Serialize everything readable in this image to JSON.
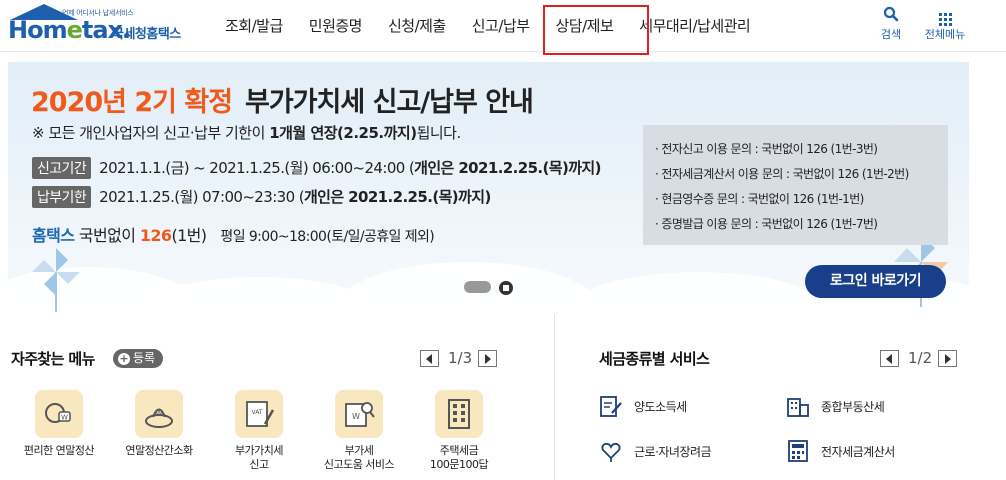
{
  "header": {
    "logo_sub": "언제 어디서나 납세서비스",
    "logo_main_pre": "Hom",
    "logo_main_e": "e",
    "logo_main_post": "tax.",
    "logo_kor": "국세청홈택스",
    "nav": [
      "조회/발급",
      "민원증명",
      "신청/제출",
      "신고/납부",
      "상담/제보",
      "세무대리/납세관리"
    ],
    "search_label": "검색",
    "all_menu_label": "전체메뉴"
  },
  "banner": {
    "title_orange": "2020년 2기 확정",
    "title_dark": "부가가치세 신고/납부 안내",
    "notice_pre": "※ 모든 개인사업자의 신고·납부 기한이 ",
    "notice_bold": "1개월 연장(2.25.까지)",
    "notice_post": "됩니다.",
    "report_tag": "신고기간",
    "report_text": "2021.1.1.(금) ~ 2021.1.25.(월) 06:00~24:00 (",
    "report_bold": "개인은 2021.2.25.(목)",
    "report_end": "까지)",
    "pay_tag": "납부기한",
    "pay_text": "2021.1.25.(월) 07:00~23:30 (",
    "pay_bold": "개인은 2021.2.25.(목)",
    "pay_end": "까지)",
    "contact_hometax": "홈택스",
    "contact_mid": " 국번없이 ",
    "contact_num": "126",
    "contact_ext": "(1번)",
    "contact_hours": "평일 9:00~18:00(토/일/공휴일 제외)",
    "info": [
      "· 전자신고 이용 문의 : 국번없이 126 (1번-3번)",
      "· 전자세금계산서 이용 문의 : 국번없이 126 (1번-2번)",
      "· 현금영수증 문의 : 국번없이 126 (1번-1번)",
      "· 증명발급 이용 문의 : 국번없이 126 (1번-7번)"
    ],
    "login_button": "로그인 바로가기"
  },
  "favorites": {
    "title": "자주찾는 메뉴",
    "register": "등록",
    "page": "1/3",
    "items": [
      {
        "label1": "편리한 연말정산",
        "label2": ""
      },
      {
        "label1": "연말정산간소화",
        "label2": ""
      },
      {
        "label1": "부가가치세",
        "label2": "신고"
      },
      {
        "label1": "부가세",
        "label2": "신고도움 서비스"
      },
      {
        "label1": "주택세금",
        "label2": "100문100답"
      }
    ]
  },
  "tax_services": {
    "title": "세금종류별 서비스",
    "page": "1/2",
    "items": [
      "양도소득세",
      "종합부동산세",
      "근로·자녀장려금",
      "전자세금계산서"
    ]
  },
  "colors": {
    "brand_blue": "#1e5fae",
    "accent_orange": "#f25a1b",
    "login_navy": "#1a3f8a",
    "active_outline": "#e02020"
  }
}
